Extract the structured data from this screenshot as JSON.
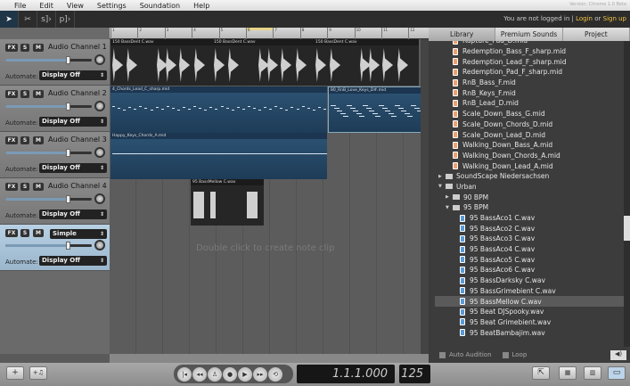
{
  "version": "Version: Chrome 1.0 Beta",
  "menu": [
    "File",
    "Edit",
    "View",
    "Settings",
    "Soundation",
    "Help"
  ],
  "tools": [
    {
      "icon": "pointer-icon",
      "glyph": "➤"
    },
    {
      "icon": "scissors-icon",
      "glyph": "✂"
    },
    {
      "icon": "split-icon",
      "glyph": "s]›"
    },
    {
      "icon": "paste-icon",
      "glyph": "p]›"
    }
  ],
  "login": {
    "text": "You are not logged in | ",
    "login": "Login",
    "or": " or ",
    "signup": "Sign up"
  },
  "ruler": [
    "1",
    "2",
    "3",
    "4",
    "5",
    "6",
    "7",
    "8",
    "9",
    "10",
    "11",
    "12"
  ],
  "tracks": [
    {
      "name": "Audio Channel 1",
      "automate": "Display Off",
      "volume": 0.72
    },
    {
      "name": "Audio Channel 2",
      "automate": "Display Off",
      "volume": 0.72
    },
    {
      "name": "Audio Channel 3",
      "automate": "Display Off",
      "volume": 0.72
    },
    {
      "name": "Audio Channel 4",
      "automate": "Display Off",
      "volume": 0.72
    },
    {
      "name": "",
      "instrument": "Simple",
      "automate": "Display Off",
      "volume": 0.72
    }
  ],
  "track_buttons": {
    "fx": "FX",
    "solo": "S",
    "mute": "M",
    "automate_label": "Automate:"
  },
  "clips": [
    {
      "label": "150 BassDent C.wav",
      "type": "audio"
    },
    {
      "label": "150 BassDent C.wav",
      "type": "audio"
    },
    {
      "label": "150 BassDent C.wav",
      "type": "audio"
    },
    {
      "label": "4_Chords_Lead_C_sharp.mid",
      "type": "midi"
    },
    {
      "label": "80_RnB_Love_Keys_D#.mid",
      "type": "midi"
    },
    {
      "label": "Happy_Keys_Chords_A.mid",
      "type": "midi"
    },
    {
      "label": "95 BassMellow C.wav",
      "type": "audio"
    }
  ],
  "timeline_hint": "Double click to create note clip",
  "tabs": [
    "Library",
    "Premium Sounds",
    "Project"
  ],
  "files": [
    {
      "name": "Rapture_Pad_D.mid",
      "kind": "mid",
      "indent": 2
    },
    {
      "name": "Redemption_Bass_F_sharp.mid",
      "kind": "mid",
      "indent": 2
    },
    {
      "name": "Redemption_Lead_F_sharp.mid",
      "kind": "mid",
      "indent": 2
    },
    {
      "name": "Redemption_Pad_F_sharp.mid",
      "kind": "mid",
      "indent": 2
    },
    {
      "name": "RnB_Bass_F.mid",
      "kind": "mid",
      "indent": 2
    },
    {
      "name": "RnB_Keys_F.mid",
      "kind": "mid",
      "indent": 2
    },
    {
      "name": "RnB_Lead_D.mid",
      "kind": "mid",
      "indent": 2
    },
    {
      "name": "Scale_Down_Bass_G.mid",
      "kind": "mid",
      "indent": 2
    },
    {
      "name": "Scale_Down_Chords_D.mid",
      "kind": "mid",
      "indent": 2
    },
    {
      "name": "Scale_Down_Lead_D.mid",
      "kind": "mid",
      "indent": 2
    },
    {
      "name": "Walking_Down_Bass_A.mid",
      "kind": "mid",
      "indent": 2
    },
    {
      "name": "Walking_Down_Chords_A.mid",
      "kind": "mid",
      "indent": 2
    },
    {
      "name": "Walking_Down_Lead_A.mid",
      "kind": "mid",
      "indent": 2
    },
    {
      "name": "SoundScape Niedersachsen",
      "kind": "folder",
      "open": false,
      "indent": 0
    },
    {
      "name": "Urban",
      "kind": "folder",
      "open": true,
      "indent": 0
    },
    {
      "name": "90 BPM",
      "kind": "folder",
      "open": false,
      "indent": 1
    },
    {
      "name": "95 BPM",
      "kind": "folder",
      "open": true,
      "indent": 1
    },
    {
      "name": "95 BassAco1 C.wav",
      "kind": "wav",
      "indent": 3
    },
    {
      "name": "95 BassAco2 C.wav",
      "kind": "wav",
      "indent": 3
    },
    {
      "name": "95 BassAco3 C.wav",
      "kind": "wav",
      "indent": 3
    },
    {
      "name": "95 BassAco4 C.wav",
      "kind": "wav",
      "indent": 3
    },
    {
      "name": "95 BassAco5 C.wav",
      "kind": "wav",
      "indent": 3
    },
    {
      "name": "95 BassAco6 C.wav",
      "kind": "wav",
      "indent": 3
    },
    {
      "name": "95 BassDarksky C.wav",
      "kind": "wav",
      "indent": 3
    },
    {
      "name": "95 BassGrimebient C.wav",
      "kind": "wav",
      "indent": 3
    },
    {
      "name": "95 BassMellow C.wav",
      "kind": "wav",
      "indent": 3,
      "selected": true
    },
    {
      "name": "95 Beat DJSpooky.wav",
      "kind": "wav",
      "indent": 3
    },
    {
      "name": "95 Beat Grimebient.wav",
      "kind": "wav",
      "indent": 3
    },
    {
      "name": "95 BeatBambajim.wav",
      "kind": "wav",
      "indent": 3
    }
  ],
  "audition": {
    "auto": "Auto Audition",
    "loop": "Loop"
  },
  "bottom": {
    "add_track": "+",
    "add_instrument": "+♫",
    "position": "1.1.1.000",
    "tempo": "125"
  },
  "transport": [
    {
      "icon": "skip-start-icon",
      "g": "|◂"
    },
    {
      "icon": "rewind-icon",
      "g": "◂◂"
    },
    {
      "icon": "metronome-icon",
      "g": "♙"
    },
    {
      "icon": "record-icon",
      "g": "●"
    },
    {
      "icon": "play-icon",
      "g": "▶"
    },
    {
      "icon": "fast-forward-icon",
      "g": "▸▸"
    },
    {
      "icon": "loop-icon",
      "g": "⟲"
    }
  ],
  "colors": {
    "accent": "#f0c040",
    "midi_clip": "#2d5475",
    "audio_clip": "#262626",
    "selected_track": "#b8d0e4"
  }
}
